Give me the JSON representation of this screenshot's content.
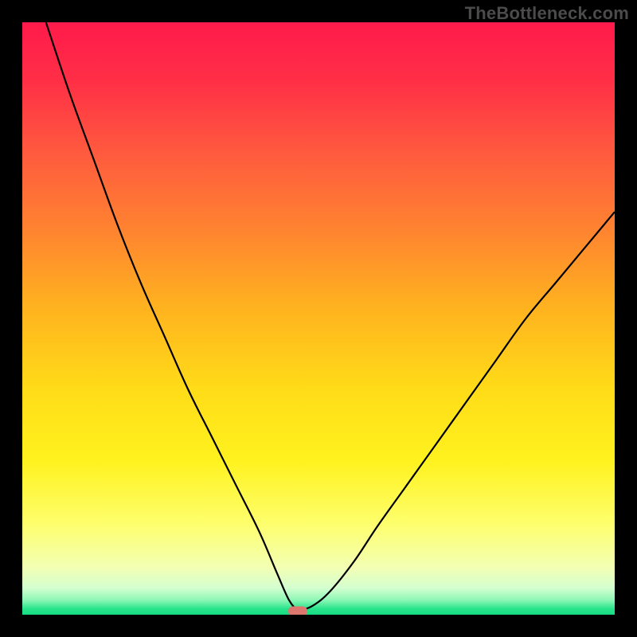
{
  "watermark": "TheBottleneck.com",
  "colors": {
    "background": "#000000",
    "watermark_text": "#4b4b4b",
    "curve_stroke": "#000000",
    "marker_fill": "#dd766f",
    "gradient_stops": [
      {
        "offset": 0.0,
        "color": "#ff1a4b"
      },
      {
        "offset": 0.1,
        "color": "#ff2f46"
      },
      {
        "offset": 0.22,
        "color": "#ff5a3e"
      },
      {
        "offset": 0.35,
        "color": "#ff8330"
      },
      {
        "offset": 0.48,
        "color": "#ffb21f"
      },
      {
        "offset": 0.62,
        "color": "#ffdc18"
      },
      {
        "offset": 0.74,
        "color": "#fff21e"
      },
      {
        "offset": 0.85,
        "color": "#feff70"
      },
      {
        "offset": 0.92,
        "color": "#f3ffb3"
      },
      {
        "offset": 0.955,
        "color": "#d4ffd0"
      },
      {
        "offset": 0.975,
        "color": "#8ef7b6"
      },
      {
        "offset": 0.99,
        "color": "#28e48b"
      },
      {
        "offset": 1.0,
        "color": "#16dd82"
      }
    ]
  },
  "chart_data": {
    "type": "line",
    "title": "",
    "xlabel": "",
    "ylabel": "",
    "xlim": [
      0,
      100
    ],
    "ylim": [
      0,
      100
    ],
    "grid": false,
    "marker": {
      "x": 46.5,
      "y": 0.6
    },
    "series": [
      {
        "name": "left-curve",
        "x": [
          4,
          8,
          12,
          16,
          20,
          24,
          28,
          32,
          36,
          40,
          43,
          45,
          46.5
        ],
        "y": [
          100,
          88,
          77,
          66,
          56,
          47,
          38,
          30,
          22,
          14,
          7,
          2.5,
          0.6
        ]
      },
      {
        "name": "right-curve",
        "x": [
          46.5,
          49,
          52,
          56,
          60,
          65,
          70,
          75,
          80,
          85,
          90,
          95,
          100
        ],
        "y": [
          0.6,
          1.5,
          4,
          9,
          15,
          22,
          29,
          36,
          43,
          50,
          56,
          62,
          68
        ]
      }
    ]
  }
}
